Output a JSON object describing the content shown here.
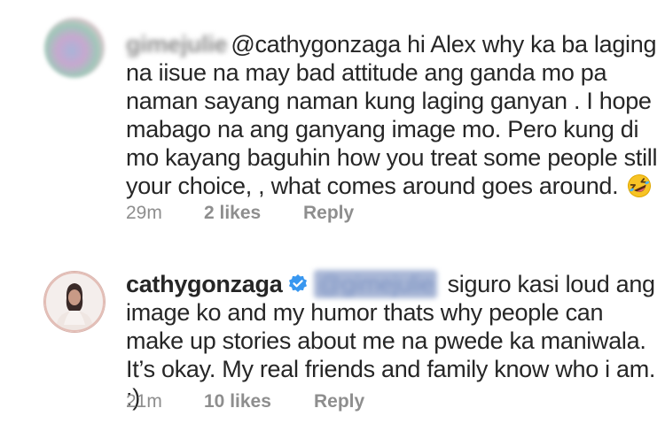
{
  "comments": [
    {
      "username": "gimejulie",
      "mention": "@cathygonzaga",
      "text": " hi Alex why ka ba laging na iisue na may bad attitude ang ganda mo pa naman sayang naman  kung laging ganyan .  I hope mabago na ang ganyang image mo. Pero kung di mo kayang baguhin how you treat some people still your choice, , what comes around goes around.",
      "emoji": "rolling-on-floor-laughing-emoji",
      "time": "29m",
      "likes": "2 likes",
      "reply": "Reply"
    },
    {
      "username": "cathygonzaga",
      "verified": true,
      "mention": "@gimejulie",
      "text": " siguro kasi loud ang image ko and my humor thats why people can make up stories about me na pwede ka maniwala. It’s okay. My real friends and family know who i am. :)",
      "time": "21m",
      "likes": "10 likes",
      "reply": "Reply"
    }
  ],
  "colors": {
    "text": "#262626",
    "meta": "#8e8e8e",
    "verified": "#3897f0",
    "mention_blur": "#a9b7d6"
  }
}
